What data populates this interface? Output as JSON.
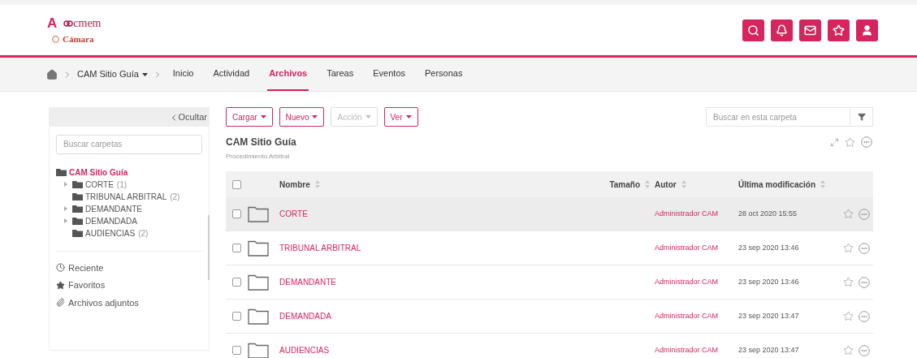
{
  "logo": {
    "mark": "A",
    "name": "cmem",
    "chamber": "Cámara"
  },
  "header_buttons": [
    {
      "kind": "search"
    },
    {
      "kind": "bell"
    },
    {
      "kind": "mail"
    },
    {
      "kind": "star"
    },
    {
      "kind": "user"
    }
  ],
  "breadcrumb": {
    "site": "CAM Sitio Guía"
  },
  "nav_tabs": [
    {
      "label": "Inicio",
      "selected": false
    },
    {
      "label": "Actividad",
      "selected": false
    },
    {
      "label": "Archivos",
      "selected": true
    },
    {
      "label": "Tareas",
      "selected": false
    },
    {
      "label": "Eventos",
      "selected": false
    },
    {
      "label": "Personas",
      "selected": false
    }
  ],
  "sidebar": {
    "hide_label": "Ocultar",
    "search": {
      "placeholder": "Buscar carpetas"
    },
    "tree": [
      {
        "label": "CAM Sitio Guía",
        "selected": true,
        "children": [
          {
            "label": "CORTE",
            "count": "(1)",
            "selected": false,
            "expandable": true
          },
          {
            "label": "TRIBUNAL ARBITRAL",
            "count": "(2)",
            "selected": false,
            "expandable": false
          },
          {
            "label": "DEMANDANTE",
            "selected": false,
            "expandable": true
          },
          {
            "label": "DEMANDADA",
            "selected": false,
            "expandable": true
          },
          {
            "label": "AUDIENCIAS",
            "count": "(2)",
            "selected": false,
            "expandable": false
          }
        ]
      }
    ],
    "links": [
      {
        "kind": "clock",
        "label": "Reciente"
      },
      {
        "kind": "star",
        "label": "Favoritos"
      },
      {
        "kind": "paperclip",
        "label": "Archivos adjuntos"
      }
    ]
  },
  "toolbar": [
    {
      "label": "Cargar",
      "disabled": false
    },
    {
      "label": "Nuevo",
      "disabled": false
    },
    {
      "label": "Acción",
      "disabled": true
    },
    {
      "label": "Ver",
      "disabled": false
    }
  ],
  "folder_search": {
    "placeholder": "Buscar en esta carpeta"
  },
  "folder": {
    "title": "CAM Sitio Guía",
    "subtitle": "Procedimiento Arbitral"
  },
  "table": {
    "select_all": {
      "checked": false
    },
    "columns": [
      "Nombre",
      "Tamaño",
      "Autor",
      "Última modificación"
    ],
    "rows": [
      {
        "name": "CORTE",
        "author": "Administrador CAM",
        "modified": "28 oct 2020 15:55",
        "highlighted": true,
        "checked": false
      },
      {
        "name": "TRIBUNAL ARBITRAL",
        "author": "Administrador CAM",
        "modified": "23 sep 2020 13:46",
        "highlighted": false,
        "checked": false
      },
      {
        "name": "DEMANDANTE",
        "author": "Administrador CAM",
        "modified": "23 sep 2020 13:46",
        "highlighted": false,
        "checked": false
      },
      {
        "name": "DEMANDADA",
        "author": "Administrador CAM",
        "modified": "23 sep 2020 13:47",
        "highlighted": false,
        "checked": false
      },
      {
        "name": "AUDIENCIAS",
        "author": "Administrador CAM",
        "modified": "23 sep 2020 13:47",
        "highlighted": false,
        "checked": false
      }
    ]
  }
}
